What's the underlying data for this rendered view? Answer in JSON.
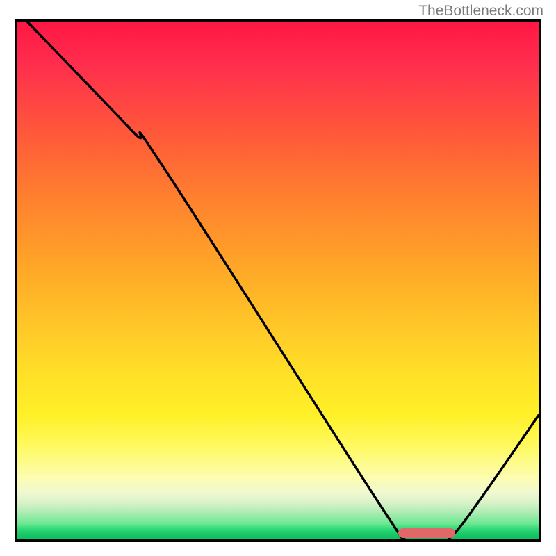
{
  "watermark": "TheBottleneck.com",
  "chart_data": {
    "type": "line",
    "title": "",
    "xlabel": "",
    "ylabel": "",
    "xlim": [
      0,
      100
    ],
    "ylim": [
      0,
      100
    ],
    "curve_points": [
      {
        "x": 2,
        "y": 100
      },
      {
        "x": 22,
        "y": 79
      },
      {
        "x": 28,
        "y": 72
      },
      {
        "x": 70,
        "y": 6
      },
      {
        "x": 74,
        "y": 1.5
      },
      {
        "x": 78,
        "y": 1.2
      },
      {
        "x": 82,
        "y": 1.2
      },
      {
        "x": 85,
        "y": 2.5
      },
      {
        "x": 100,
        "y": 24
      }
    ],
    "marker": {
      "x_start": 73,
      "x_end": 84,
      "y": 1.2,
      "color": "#e06868"
    },
    "gradient": {
      "top": "#ff1744",
      "mid": "#ffe028",
      "bottom": "#0abf5d"
    }
  }
}
